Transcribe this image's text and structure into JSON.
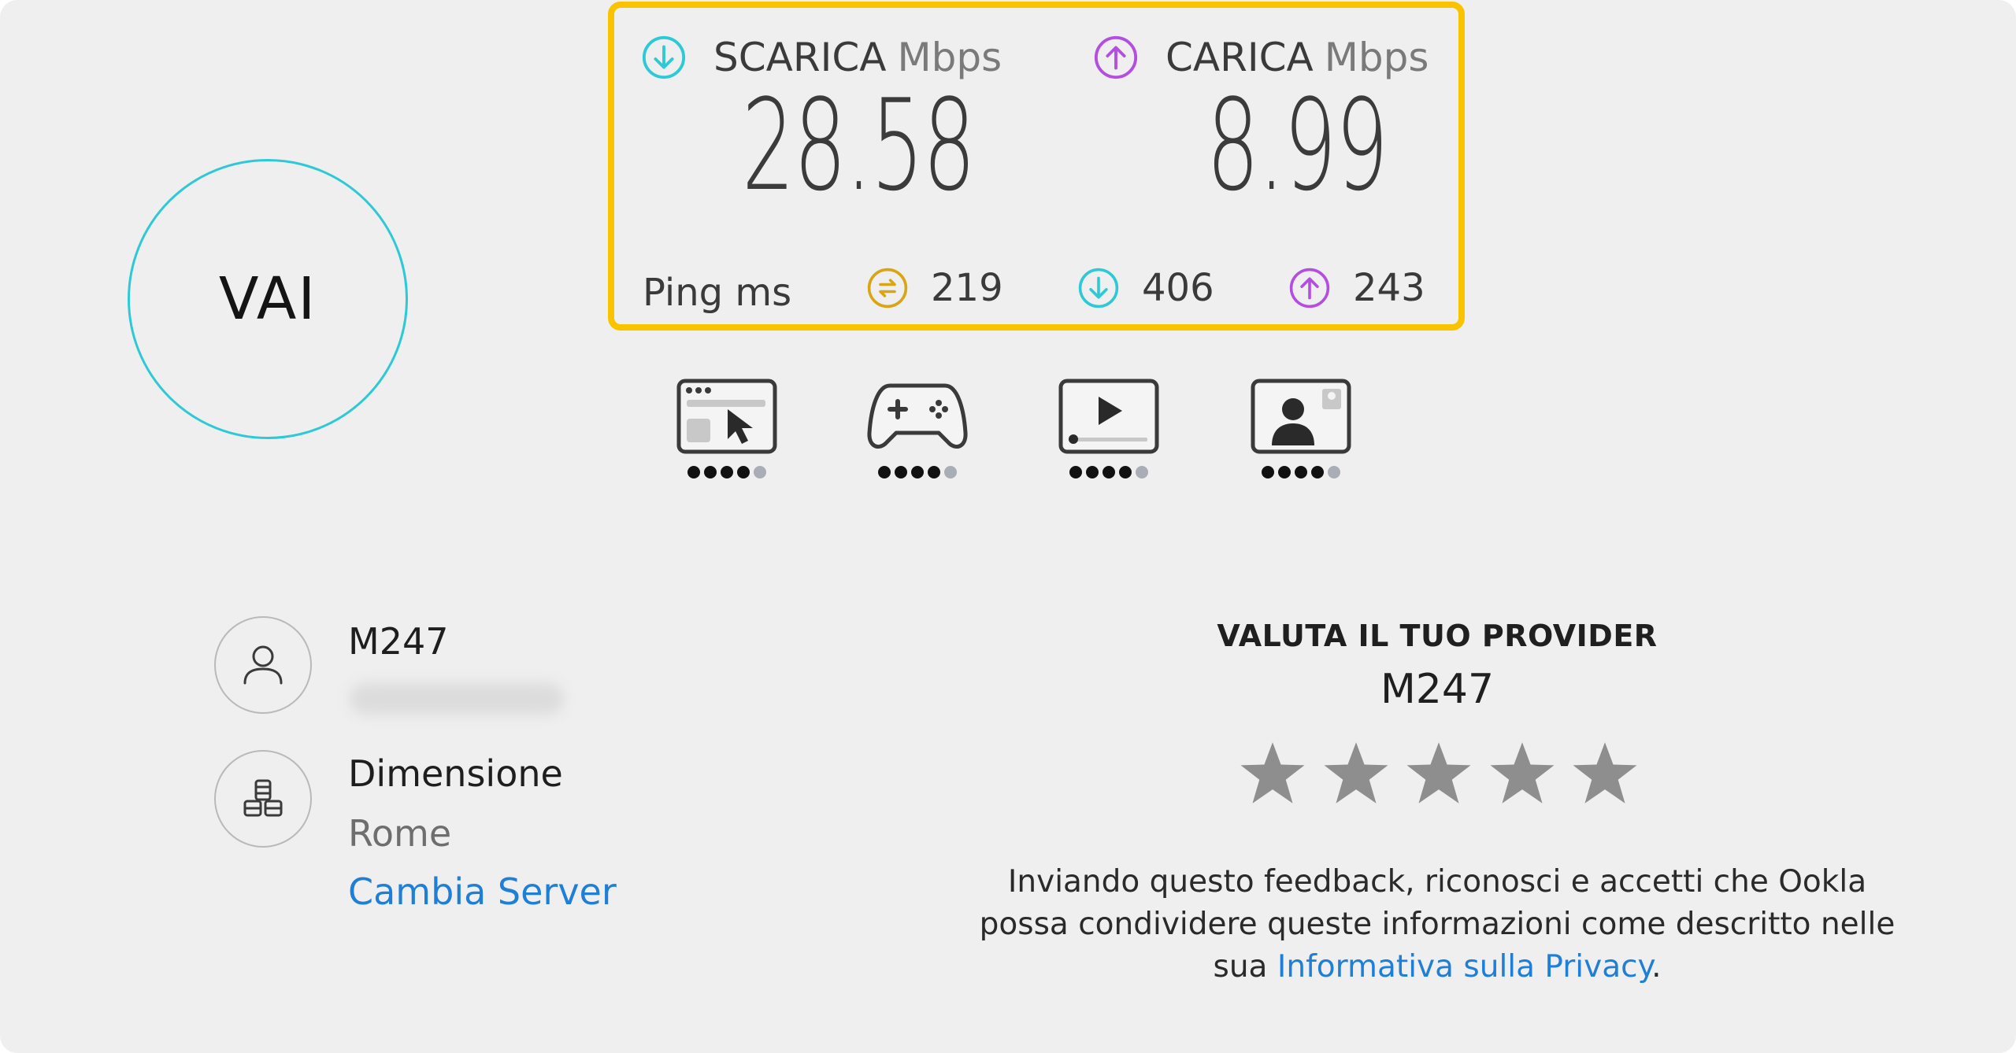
{
  "go_button": {
    "label": "VAI"
  },
  "download": {
    "label": "SCARICA",
    "unit": "Mbps",
    "value": "28.58"
  },
  "upload": {
    "label": "CARICA",
    "unit": "Mbps",
    "value": "8.99"
  },
  "ping": {
    "label": "Ping",
    "unit": "ms",
    "idle": "219",
    "download": "406",
    "upload": "243"
  },
  "quality": [
    {
      "name": "browsing",
      "icon": "browser-icon",
      "rating": 4,
      "max": 5
    },
    {
      "name": "gaming",
      "icon": "gamepad-icon",
      "rating": 4,
      "max": 5
    },
    {
      "name": "streaming",
      "icon": "video-play-icon",
      "rating": 4,
      "max": 5
    },
    {
      "name": "video-call",
      "icon": "video-call-icon",
      "rating": 4,
      "max": 5
    }
  ],
  "provider": {
    "name": "M247",
    "icon": "user-icon"
  },
  "server": {
    "name": "Dimensione",
    "location": "Rome",
    "change_label": "Cambia Server",
    "icon": "server-icon"
  },
  "rating": {
    "title": "VALUTA IL TUO PROVIDER",
    "provider": "M247",
    "stars": 5,
    "disclaimer_text": "Inviando questo feedback, riconosci e accetti che Ookla possa condividere queste informazioni come descritto nelle sua ",
    "privacy_link": "Informativa sulla Privacy",
    "disclaimer_end": "."
  },
  "colors": {
    "accent_cyan": "#2ec9d6",
    "upload_purple": "#b34ee0",
    "ping_gold": "#d9a514",
    "highlight_yellow": "#f9c300",
    "link_blue": "#1f7fd6"
  }
}
